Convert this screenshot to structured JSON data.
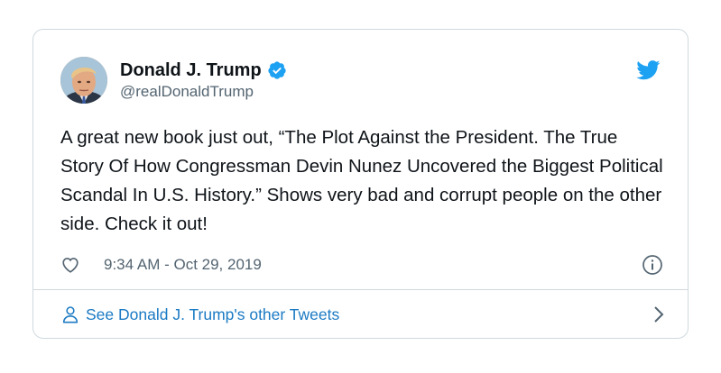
{
  "author": {
    "display_name": "Donald J. Trump",
    "handle": "@realDonaldTrump",
    "verified": true
  },
  "tweet": {
    "text": "A great new book just out, “The Plot Against the President. The True Story Of How Congressman Devin Nunez Uncovered the Biggest Political Scandal In U.S. History.” Shows very bad and corrupt people on the other side. Check it out!",
    "timestamp": "9:34 AM - Oct 29, 2019"
  },
  "footer": {
    "label": "See Donald J. Trump's other Tweets"
  },
  "colors": {
    "brand_blue": "#1da1f2",
    "link_blue": "#1b7ac4",
    "text": "#0f1419",
    "muted": "#536471",
    "border": "#cfd9de"
  },
  "icons": [
    "avatar",
    "verified-badge-icon",
    "twitter-bird-icon",
    "heart-icon",
    "info-icon",
    "person-icon",
    "chevron-right-icon"
  ]
}
